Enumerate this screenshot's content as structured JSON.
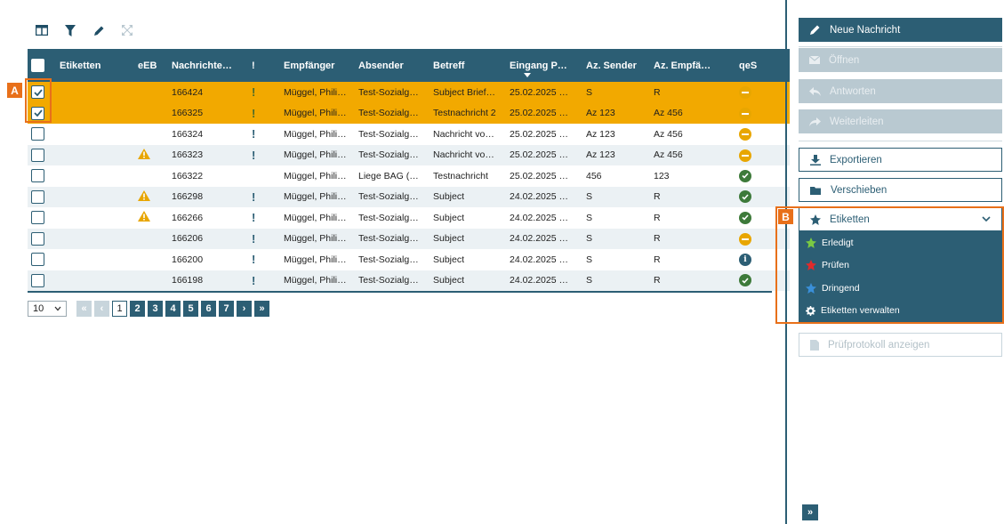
{
  "toolbar": {
    "icons": [
      "columns-icon",
      "filter-icon",
      "edit-icon",
      "fullscreen-icon"
    ]
  },
  "grid": {
    "columns": [
      "Etiketten",
      "eEB",
      "Nachrichte…",
      "!",
      "Empfänger",
      "Absender",
      "Betreff",
      "Eingang P…",
      "Az. Sender",
      "Az. Empfä…",
      "qeS"
    ],
    "rows": [
      {
        "selected": true,
        "warn": false,
        "id": "166424",
        "important": true,
        "recipient": "Müggel, Phili…",
        "sender": "Test-Sozialg…",
        "subject": "Subject Brief…",
        "date": "25.02.2025 …",
        "az_sender": "S",
        "az_recipient": "R",
        "status": "pending"
      },
      {
        "selected": true,
        "warn": false,
        "id": "166325",
        "important": true,
        "recipient": "Müggel, Phili…",
        "sender": "Test-Sozialg…",
        "subject": "Testnachricht 2",
        "date": "25.02.2025 …",
        "az_sender": "Az 123",
        "az_recipient": "Az 456",
        "status": "pending"
      },
      {
        "selected": false,
        "warn": false,
        "id": "166324",
        "important": true,
        "recipient": "Müggel, Phili…",
        "sender": "Test-Sozialg…",
        "subject": "Nachricht vo…",
        "date": "25.02.2025 …",
        "az_sender": "Az 123",
        "az_recipient": "Az 456",
        "status": "pending"
      },
      {
        "selected": false,
        "warn": true,
        "id": "166323",
        "important": true,
        "recipient": "Müggel, Phili…",
        "sender": "Test-Sozialg…",
        "subject": "Nachricht vo…",
        "date": "25.02.2025 …",
        "az_sender": "Az 123",
        "az_recipient": "Az 456",
        "status": "pending"
      },
      {
        "selected": false,
        "warn": false,
        "id": "166322",
        "important": false,
        "recipient": "Müggel, Phili…",
        "sender": "Liege BAG (…",
        "subject": "Testnachricht",
        "date": "25.02.2025 …",
        "az_sender": "456",
        "az_recipient": "123",
        "status": "ok"
      },
      {
        "selected": false,
        "warn": true,
        "id": "166298",
        "important": true,
        "recipient": "Müggel, Phili…",
        "sender": "Test-Sozialg…",
        "subject": "Subject",
        "date": "24.02.2025 …",
        "az_sender": "S",
        "az_recipient": "R",
        "status": "ok"
      },
      {
        "selected": false,
        "warn": true,
        "id": "166266",
        "important": true,
        "recipient": "Müggel, Phili…",
        "sender": "Test-Sozialg…",
        "subject": "Subject",
        "date": "24.02.2025 …",
        "az_sender": "S",
        "az_recipient": "R",
        "status": "ok"
      },
      {
        "selected": false,
        "warn": false,
        "id": "166206",
        "important": true,
        "recipient": "Müggel, Phili…",
        "sender": "Test-Sozialg…",
        "subject": "Subject",
        "date": "24.02.2025 …",
        "az_sender": "S",
        "az_recipient": "R",
        "status": "pending"
      },
      {
        "selected": false,
        "warn": false,
        "id": "166200",
        "important": true,
        "recipient": "Müggel, Phili…",
        "sender": "Test-Sozialg…",
        "subject": "Subject",
        "date": "24.02.2025 …",
        "az_sender": "S",
        "az_recipient": "R",
        "status": "info"
      },
      {
        "selected": false,
        "warn": false,
        "id": "166198",
        "important": true,
        "recipient": "Müggel, Phili…",
        "sender": "Test-Sozialg…",
        "subject": "Subject",
        "date": "24.02.2025 …",
        "az_sender": "S",
        "az_recipient": "R",
        "status": "ok"
      }
    ]
  },
  "pager": {
    "page_size": "10",
    "first": "«",
    "prev": "‹",
    "pages": [
      "1",
      "2",
      "3",
      "4",
      "5",
      "6",
      "7"
    ],
    "current_page": "1",
    "next": "›",
    "last": "»"
  },
  "sidebar": {
    "new_message": "Neue Nachricht",
    "open": "Öffnen",
    "reply": "Antworten",
    "forward": "Weiterleiten",
    "export": "Exportieren",
    "move": "Verschieben",
    "labels": "Etiketten",
    "label_menu": [
      {
        "label": "Erledigt",
        "color": "#7ac943"
      },
      {
        "label": "Prüfen",
        "color": "#e02b2b"
      },
      {
        "label": "Dringend",
        "color": "#3a8fd9"
      },
      {
        "label": "Etiketten verwalten",
        "color": "#ffffff"
      }
    ],
    "protocol": "Prüfprotokoll anzeigen",
    "expand": "»"
  },
  "markers": {
    "a": "A",
    "b": "B"
  },
  "colors": {
    "primary": "#2c5e74",
    "selected_row": "#f2a900",
    "accent_marker": "#e8701a",
    "warn": "#e8a600",
    "ok": "#3d7a3a"
  }
}
